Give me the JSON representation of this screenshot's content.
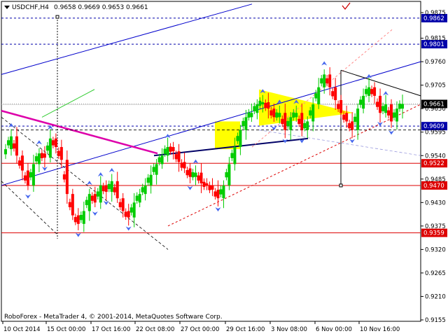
{
  "header": {
    "symbol": "USDCHF,H4",
    "ohlc": "0.9658 0.9669 0.9653 0.9661"
  },
  "footer": {
    "copyright": "RoboForex - MetaTrader 4, © 2001-2014, MetaQuotes Software Corp."
  },
  "colors": {
    "bull": "#00cc00",
    "bear": "#ff0000",
    "level": "#dd0000",
    "trend": "#0000cc",
    "pattern": "#ffff00",
    "arrow": "#4466ee",
    "magenta": "#dd00aa"
  },
  "chart_data": {
    "type": "candlestick",
    "symbol": "USDCHF",
    "timeframe": "H4",
    "ylim": [
      0.9145,
      0.9895
    ],
    "y_ticks": [
      "0.9875",
      "0.9815",
      "0.9760",
      "0.9705",
      "0.9650",
      "0.9595",
      "0.9540",
      "0.9485",
      "0.9430",
      "0.9375",
      "0.9320",
      "0.9265",
      "0.9210",
      "0.9155"
    ],
    "x_ticks": [
      "10 Oct 2014",
      "15 Oct 00:00",
      "17 Oct 16:00",
      "22 Oct 08:00",
      "27 Oct 00:00",
      "29 Oct 16:00",
      "3 Nov 08:00",
      "6 Nov 00:00",
      "10 Nov 16:00"
    ],
    "price_labels": [
      {
        "value": 0.9862,
        "text": "0.9862",
        "kind": "level"
      },
      {
        "value": 0.9801,
        "text": "0.9801",
        "kind": "level"
      },
      {
        "value": 0.9661,
        "text": "0.9661",
        "kind": "current"
      },
      {
        "value": 0.9609,
        "text": "0.9609",
        "kind": "level"
      },
      {
        "value": 0.9522,
        "text": "0.9522",
        "kind": "support"
      },
      {
        "value": 0.947,
        "text": "0.9470",
        "kind": "support"
      },
      {
        "value": 0.9359,
        "text": "0.9359",
        "kind": "support"
      }
    ],
    "price_path": [
      0.9555,
      0.9585,
      0.954,
      0.9505,
      0.947,
      0.952,
      0.9545,
      0.9535,
      0.958,
      0.956,
      0.953,
      0.945,
      0.94,
      0.938,
      0.941,
      0.945,
      0.943,
      0.947,
      0.9455,
      0.948,
      0.944,
      0.941,
      0.9395,
      0.943,
      0.945,
      0.947,
      0.9495,
      0.952,
      0.954,
      0.956,
      0.955,
      0.9525,
      0.951,
      0.949,
      0.95,
      0.9475,
      0.947,
      0.946,
      0.944,
      0.947,
      0.952,
      0.956,
      0.96,
      0.963,
      0.964,
      0.966,
      0.9665,
      0.965,
      0.963,
      0.964,
      0.96,
      0.963,
      0.964,
      0.96,
      0.962,
      0.966,
      0.97,
      0.973,
      0.97,
      0.967,
      0.964,
      0.962,
      0.96,
      0.965,
      0.968,
      0.97,
      0.968,
      0.964,
      0.966,
      0.962,
      0.965,
      0.9661
    ]
  }
}
